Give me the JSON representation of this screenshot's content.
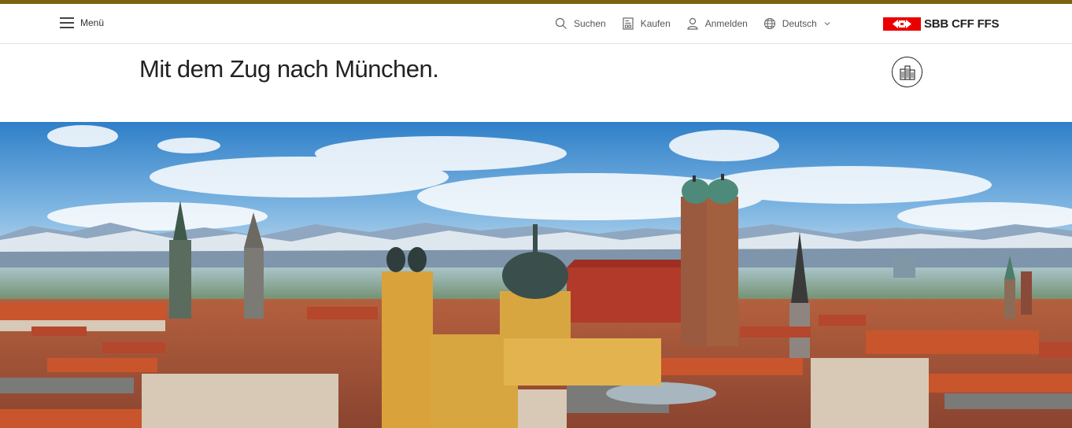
{
  "header": {
    "menu_label": "Menü",
    "nav": {
      "search": "Suchen",
      "buy": "Kaufen",
      "login": "Anmelden",
      "language": "Deutsch"
    },
    "logo_text": "SBB CFF FFS"
  },
  "main": {
    "title": "Mit dem Zug nach München."
  },
  "icons": {
    "menu": "hamburger-icon",
    "search": "search-icon",
    "buy": "ticket-icon",
    "login": "user-icon",
    "language": "globe-icon",
    "language_dropdown": "chevron-down-icon",
    "city": "city-buildings-icon"
  },
  "colors": {
    "accent_bar": "#7a6410",
    "brand_red": "#eb0000",
    "text": "#222222"
  }
}
